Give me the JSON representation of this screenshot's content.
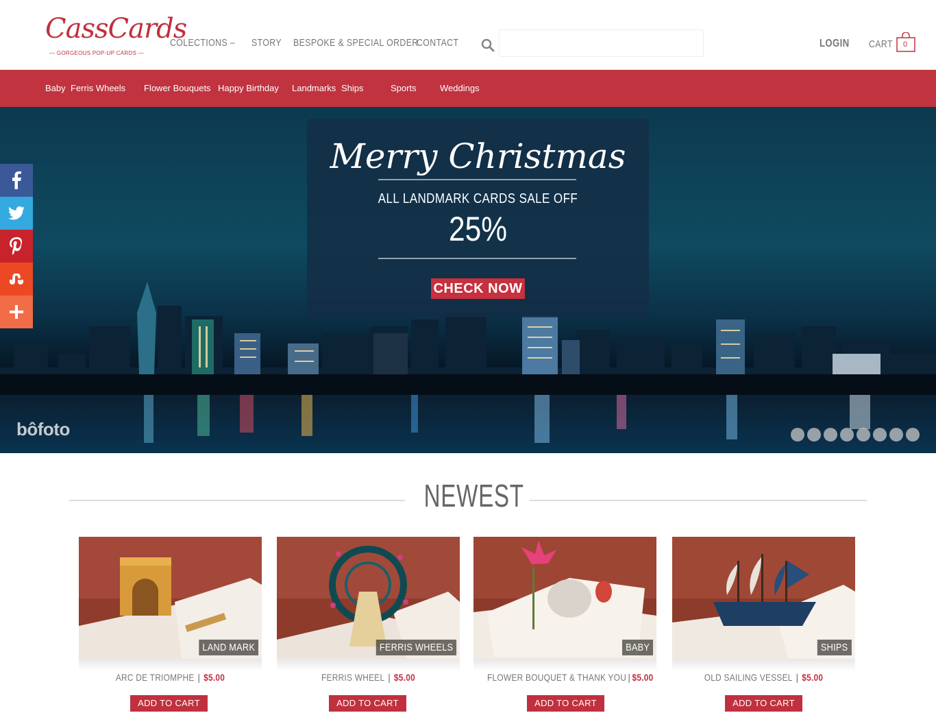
{
  "header": {
    "logo_main": "CassCards",
    "logo_sub": "— GORGEOUS POP-UP CARDS —",
    "nav": [
      "COLECTIONS",
      "STORY",
      "BESPOKE & SPECIAL ORDER",
      "CONTACT"
    ],
    "search_placeholder": "",
    "login": "LOGIN",
    "cart_label": "CART",
    "cart_count": "0"
  },
  "categories": [
    "Baby",
    "Ferris Wheels",
    "Flower Bouquets",
    "Happy Birthday",
    "Landmarks",
    "Ships",
    "Sports",
    "Weddings"
  ],
  "hero": {
    "title": "Merry Christmas",
    "subtitle": "ALL LANDMARK CARDS SALE OFF",
    "discount": "25%",
    "button": "CHECK NOW",
    "watermark": "bôfoto",
    "slide_count": 8,
    "active_slide": 1
  },
  "social": [
    {
      "icon": "facebook-icon",
      "glyph": "f",
      "color": "#3b5998"
    },
    {
      "icon": "twitter-icon",
      "glyph": "t",
      "color": "#34a9df"
    },
    {
      "icon": "pinterest-icon",
      "glyph": "P",
      "color": "#c8232c"
    },
    {
      "icon": "stumbleupon-icon",
      "glyph": "su",
      "color": "#eb4924"
    },
    {
      "icon": "more-share-icon",
      "glyph": "+",
      "color": "#f16c47"
    }
  ],
  "section_title": "NEWEST",
  "products": [
    {
      "name": "ARC DE TRIOMPHE",
      "price": "$5.00",
      "tag": "LAND MARK",
      "button": "ADD TO CART"
    },
    {
      "name": "FERRIS WHEEL",
      "price": "$5.00",
      "tag": "FERRIS WHEELS",
      "button": "ADD TO CART"
    },
    {
      "name": "FLOWER BOUQUET & THANK YOU",
      "price": "$5.00",
      "tag": "BABY",
      "button": "ADD TO CART"
    },
    {
      "name": "OLD SAILING VESSEL",
      "price": "$5.00",
      "tag": "SHIPS",
      "button": "ADD TO CART"
    }
  ],
  "colors": {
    "brand_red": "#c0333f",
    "text_gray": "#777777"
  }
}
